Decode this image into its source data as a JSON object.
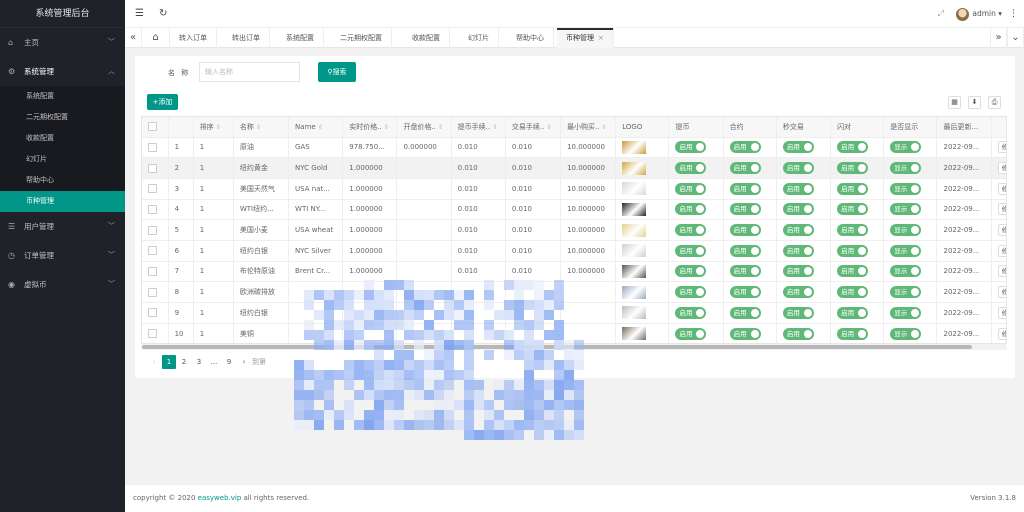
{
  "app": {
    "title": "系统管理后台"
  },
  "sidebar": {
    "items": [
      {
        "label": "主页",
        "icon": "home-icon"
      },
      {
        "label": "系统管理",
        "icon": "gear-icon",
        "children": [
          "系统配置",
          "二元期权配置",
          "收款配置",
          "幻灯片",
          "帮助中心",
          "币种管理"
        ]
      },
      {
        "label": "用户管理",
        "icon": "user-icon"
      },
      {
        "label": "订单管理",
        "icon": "clock-icon"
      },
      {
        "label": "虚拟币",
        "icon": "coin-icon"
      }
    ],
    "active_child": "币种管理"
  },
  "header": {
    "user": "admin"
  },
  "tabs": [
    "转入订单",
    "转出订单",
    "系统配置",
    "二元期权配置",
    "收款配置",
    "幻灯片",
    "帮助中心",
    "币种管理"
  ],
  "search": {
    "label": "名 称",
    "placeholder": "输入名称",
    "button": "搜索"
  },
  "toolbar": {
    "add": "添加"
  },
  "table": {
    "columns": [
      "排序",
      "名称",
      "Name",
      "实时价格..",
      "开盘价格..",
      "提币手续..",
      "交易手续..",
      "最小购买..",
      "LOGO",
      "提币",
      "合约",
      "秒交易",
      "闪对",
      "是否显示",
      "最后更新..."
    ],
    "rows": [
      {
        "no": "1",
        "sort": "1",
        "name": "原油",
        "en": "GAS",
        "price": "978.750...",
        "open": "0.000000",
        "fee1": "0.010",
        "fee2": "0.010",
        "min": "10.000000",
        "date": "2022-09...",
        "logo": "#c89b3c"
      },
      {
        "no": "2",
        "sort": "1",
        "name": "纽约黄金",
        "en": "NYC Gold",
        "price": "1.000000",
        "open": "",
        "fee1": "0.010",
        "fee2": "0.010",
        "min": "10.000000",
        "date": "2022-09...",
        "logo": "#d4a640"
      },
      {
        "no": "3",
        "sort": "1",
        "name": "美国天然气",
        "en": "USA nat...",
        "price": "1.000000",
        "open": "",
        "fee1": "0.010",
        "fee2": "0.010",
        "min": "10.000000",
        "date": "2022-09...",
        "logo": "#d8d8d8"
      },
      {
        "no": "4",
        "sort": "1",
        "name": "WTI纽约...",
        "en": "WTI NY...",
        "price": "1.000000",
        "open": "",
        "fee1": "0.010",
        "fee2": "0.010",
        "min": "10.000000",
        "date": "2022-09...",
        "logo": "#222222"
      },
      {
        "no": "5",
        "sort": "1",
        "name": "美国小麦",
        "en": "USA wheat",
        "price": "1.000000",
        "open": "",
        "fee1": "0.010",
        "fee2": "0.010",
        "min": "10.000000",
        "date": "2022-09...",
        "logo": "#e0d090"
      },
      {
        "no": "6",
        "sort": "1",
        "name": "纽约白银",
        "en": "NYC Silver",
        "price": "1.000000",
        "open": "",
        "fee1": "0.010",
        "fee2": "0.010",
        "min": "10.000000",
        "date": "2022-09...",
        "logo": "#cfcfcf"
      },
      {
        "no": "7",
        "sort": "1",
        "name": "布伦特原油",
        "en": "Brent Cr...",
        "price": "1.000000",
        "open": "",
        "fee1": "0.010",
        "fee2": "0.010",
        "min": "10.000000",
        "date": "2022-09...",
        "logo": "#555555"
      },
      {
        "no": "8",
        "sort": "1",
        "name": "欧洲碳排放",
        "en": "",
        "price": "",
        "open": "",
        "fee1": "",
        "fee2": "",
        "min": "",
        "date": "2022-09...",
        "logo": "#9aa8c0"
      },
      {
        "no": "9",
        "sort": "1",
        "name": "纽约白银",
        "en": "",
        "price": "",
        "open": "",
        "fee1": "",
        "fee2": "",
        "min": "",
        "date": "2022-09...",
        "logo": "#bbbbbb"
      },
      {
        "no": "10",
        "sort": "1",
        "name": "美铜",
        "en": "",
        "price": "",
        "open": "",
        "fee1": "",
        "fee2": "",
        "min": "",
        "date": "2022-09...",
        "logo": "#7a6a5a"
      }
    ],
    "switch_label": "启用",
    "display_label": "显示",
    "action_label": "修"
  },
  "pager": {
    "pages": [
      "1",
      "2",
      "3",
      "...",
      "9"
    ],
    "current": "1",
    "goto": "到第"
  },
  "footer": {
    "copyright_prefix": "copyright © 2020 ",
    "brand": "easyweb.vip",
    "copyright_suffix": " all rights reserved.",
    "version": "Version 3.1.8"
  },
  "colors": {
    "accent": "#009688",
    "sidebar": "#20222a",
    "switch": "#5fb878"
  }
}
